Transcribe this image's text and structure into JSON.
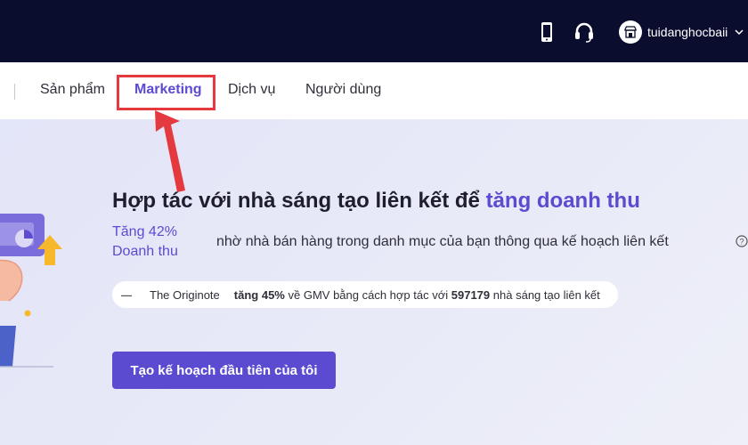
{
  "header": {
    "username": "tuidanghocbaii"
  },
  "nav": {
    "items": [
      "Sản phẩm",
      "Marketing",
      "Dịch vụ",
      "Người dùng"
    ],
    "active_index": 1
  },
  "hero": {
    "headline_prefix": "Hợp tác với nhà sáng tạo liên kết để",
    "headline_accent": "tăng doanh thu",
    "stat_line1": "Tăng 42%",
    "stat_line2": "Doanh thu",
    "subtext": "nhờ nhà bán hàng trong danh mục của bạn thông qua kế hoạch liên kết",
    "testimonial": {
      "brand": "The Originote",
      "t1": "tăng",
      "percent": "45%",
      "t2": "về GMV bằng cách hợp tác với",
      "count": "597179",
      "t3": "nhà sáng tạo liên kết"
    },
    "cta_label": "Tạo kế hoạch đầu tiên của tôi"
  },
  "colors": {
    "topbar": "#0b0d2e",
    "accent": "#5b4bd1",
    "annotation": "#e43a3f"
  },
  "icons": [
    "phone-icon",
    "headset-icon",
    "store-icon",
    "chevron-down-icon",
    "help-icon"
  ]
}
